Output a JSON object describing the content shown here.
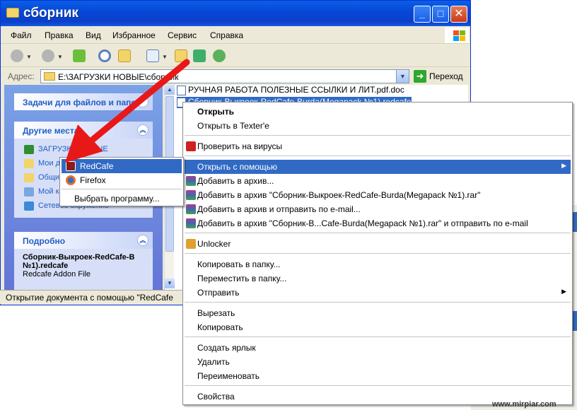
{
  "window": {
    "title": "сборник"
  },
  "menubar": [
    "Файл",
    "Правка",
    "Вид",
    "Избранное",
    "Сервис",
    "Справка"
  ],
  "address": {
    "label": "Адрес:",
    "value": "E:\\ЗАГРУЗКИ НОВЫЕ\\сборник",
    "go_label": "Переход"
  },
  "leftpane": {
    "tasks_title": "Задачи для файлов и папок",
    "places_title": "Другие места",
    "places": [
      "ЗАГРУЗКИ НОВЫЕ",
      "Мои д",
      "Общи",
      "Мой к",
      "Сетевое окружение"
    ],
    "details_title": "Подробно",
    "detail_name": "Сборник-Выкроек-RedCafe-B №1).redcafe",
    "detail_type": "Redcafe Addon File"
  },
  "files": [
    {
      "name": "РУЧНАЯ РАБОТА ПОЛЕЗНЫЕ ССЫЛКИ И ЛИТ.pdf.doc",
      "selected": false
    },
    {
      "name": "Сборник-Выкроек-RedCafe-Burda(Megapack №1).redcafe",
      "selected": true
    }
  ],
  "statusbar": {
    "text": "Открытие документа с помощью \"RedCafe"
  },
  "context_menu": {
    "items": [
      {
        "label": "Открыть",
        "bold": true
      },
      {
        "label": "Открыть в Texter'e"
      },
      {
        "label": "Проверить на вирусы",
        "icon": "antivirus"
      },
      {
        "label": "Открыть с помощью",
        "highlight": true,
        "submenu": true
      },
      {
        "label": "Добавить в архив...",
        "icon": "winrar"
      },
      {
        "label": "Добавить в архив \"Сборник-Выкроек-RedCafe-Burda(Megapack №1).rar\"",
        "icon": "winrar"
      },
      {
        "label": "Добавить в архив и отправить по e-mail...",
        "icon": "winrar"
      },
      {
        "label": "Добавить в архив \"Сборник-В...Cafe-Burda(Megapack №1).rar\" и отправить по e-mail",
        "icon": "winrar"
      },
      {
        "label": "Unlocker",
        "icon": "unlocker"
      },
      {
        "label": "Копировать в папку..."
      },
      {
        "label": "Переместить в папку..."
      },
      {
        "label": "Отправить",
        "submenu": true
      },
      {
        "label": "Вырезать"
      },
      {
        "label": "Копировать"
      },
      {
        "label": "Создать ярлык"
      },
      {
        "label": "Удалить"
      },
      {
        "label": "Переименовать"
      },
      {
        "label": "Свойства"
      }
    ]
  },
  "open_with_menu": {
    "items": [
      {
        "label": "RedCafe",
        "highlight": true,
        "icon": "redcafe"
      },
      {
        "label": "Firefox",
        "icon": "firefox"
      },
      {
        "label": "Выбрать программу..."
      }
    ]
  },
  "colors": {
    "highlight": "#316ac5",
    "titlebar": "#0a4fd8",
    "annotation_arrow": "#e81818"
  },
  "watermark": "www.mirpiar.com"
}
